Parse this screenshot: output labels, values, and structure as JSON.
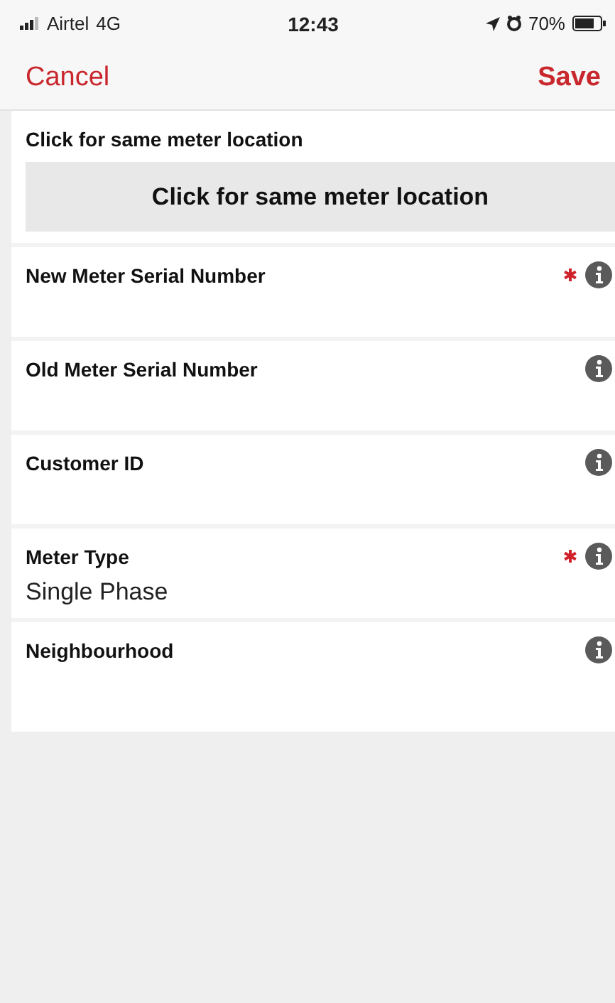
{
  "status_bar": {
    "carrier": "Airtel",
    "network": "4G",
    "time": "12:43",
    "battery": "70%"
  },
  "nav": {
    "cancel": "Cancel",
    "save": "Save"
  },
  "location": {
    "label": "Click for same meter location",
    "button": "Click for same meter location"
  },
  "fields": [
    {
      "label": "New Meter Serial Number",
      "required": true
    },
    {
      "label": "Old Meter Serial Number",
      "required": false
    },
    {
      "label": "Customer ID",
      "required": false
    },
    {
      "label": "Meter Type",
      "required": true,
      "value": "Single Phase"
    },
    {
      "label": "Neighbourhood",
      "required": false
    }
  ]
}
